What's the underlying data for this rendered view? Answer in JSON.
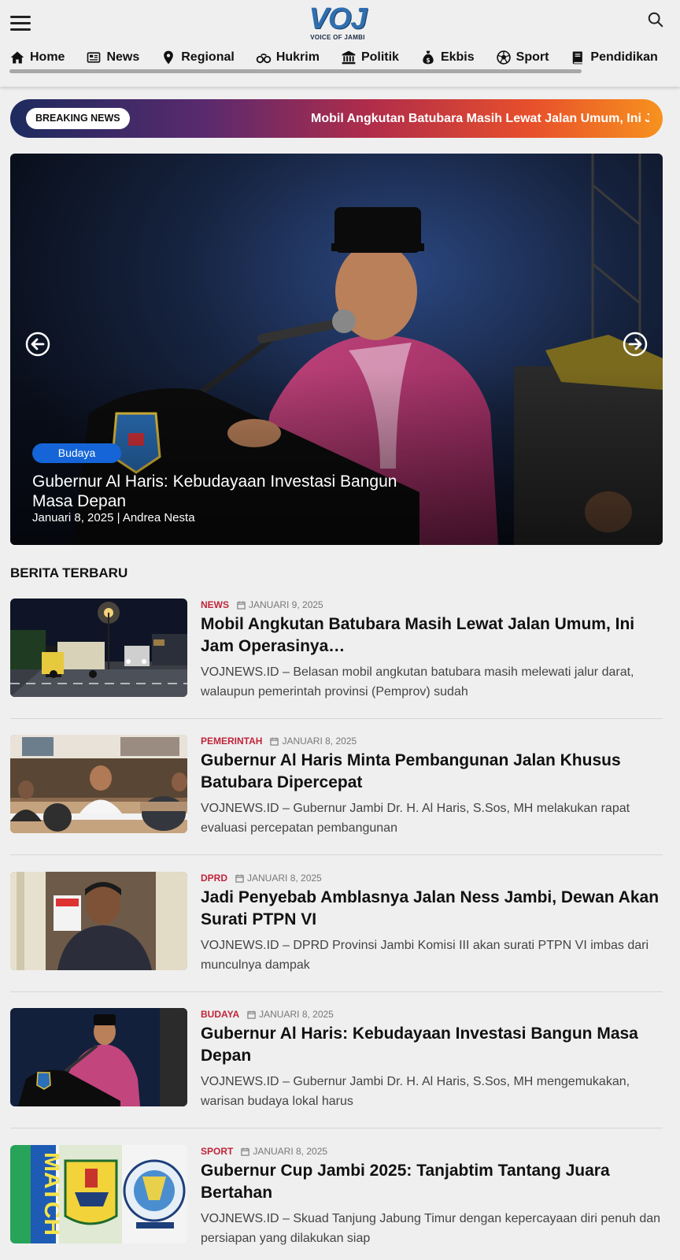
{
  "header": {
    "logo_text": "VOJ",
    "logo_sub": "VOICE OF JAMBI"
  },
  "nav": {
    "items": [
      {
        "label": "Home",
        "icon": "home-icon"
      },
      {
        "label": "News",
        "icon": "newspaper-icon"
      },
      {
        "label": "Regional",
        "icon": "map-pin-icon"
      },
      {
        "label": "Hukrim",
        "icon": "handcuffs-icon"
      },
      {
        "label": "Politik",
        "icon": "landmark-icon"
      },
      {
        "label": "Ekbis",
        "icon": "money-bag-icon"
      },
      {
        "label": "Sport",
        "icon": "soccer-ball-icon"
      },
      {
        "label": "Pendidikan",
        "icon": "book-icon"
      }
    ]
  },
  "breaking": {
    "badge": "BREAKING NEWS",
    "text": "Mobil Angkutan Batubara Masih Lewat Jalan Umum, Ini Jam Operasinya"
  },
  "hero": {
    "category": "Budaya",
    "title": "Gubernur Al Haris: Kebudayaan Investasi Bangun Masa Depan",
    "meta": "Januari 8, 2025 | Andrea Nesta"
  },
  "section": {
    "title": "BERITA TERBARU"
  },
  "articles": [
    {
      "category": "NEWS",
      "date": "JANUARI 9, 2025",
      "title": "Mobil Angkutan Batubara Masih Lewat Jalan Umum, Ini Jam Operasinya…",
      "excerpt": "VOJNEWS.ID – Belasan mobil angkutan batubara masih melewati jalur darat, walaupun pemerintah provinsi (Pemprov) sudah"
    },
    {
      "category": "PEMERINTAH",
      "date": "JANUARI 8, 2025",
      "title": "Gubernur Al Haris Minta Pembangunan Jalan Khusus Batubara Dipercepat",
      "excerpt": "VOJNEWS.ID – Gubernur Jambi Dr. H. Al Haris, S.Sos, MH melakukan rapat evaluasi percepatan pembangunan"
    },
    {
      "category": "DPRD",
      "date": "JANUARI 8, 2025",
      "title": "Jadi Penyebab Amblasnya Jalan Ness Jambi, Dewan Akan Surati PTPN VI",
      "excerpt": "VOJNEWS.ID – DPRD Provinsi Jambi Komisi III akan surati PTPN VI imbas dari munculnya dampak"
    },
    {
      "category": "BUDAYA",
      "date": "JANUARI 8, 2025",
      "title": "Gubernur Al Haris: Kebudayaan Investasi Bangun Masa Depan",
      "excerpt": "VOJNEWS.ID – Gubernur Jambi Dr. H. Al Haris, S.Sos, MH mengemukakan, warisan budaya lokal harus"
    },
    {
      "category": "SPORT",
      "date": "JANUARI 8, 2025",
      "title": "Gubernur Cup Jambi 2025: Tanjabtim Tantang Juara Bertahan",
      "excerpt": "VOJNEWS.ID – Skuad Tanjung Jabung Timur dengan kepercayaan diri penuh dan persiapan yang dilakukan siap"
    }
  ],
  "thumb_text": {
    "match_banner": "MATCH"
  },
  "colors": {
    "accent_blue": "#1565d8",
    "category_red": "#c0243a",
    "logo_blue": "#2f6fb0"
  }
}
